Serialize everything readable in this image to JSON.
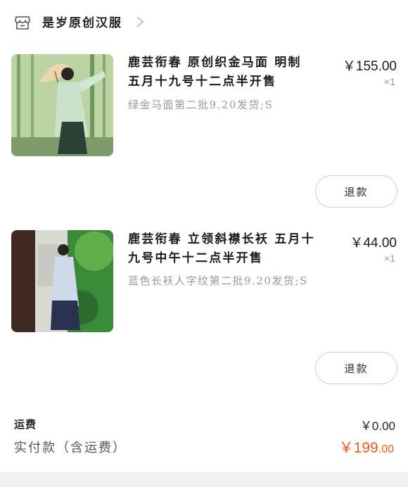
{
  "header": {
    "shop_name": "是岁原创汉服"
  },
  "items": [
    {
      "title_line1": "鹿芸衔春 原创织金马面 明制",
      "title_line2": "五月十九号十二点半开售",
      "sku": "绿金马面第二批9.20发货;S",
      "price": "￥155.00",
      "qty": "×1",
      "refund_label": "退款"
    },
    {
      "title_line1": "鹿芸衔春 立领斜襟长袄 五月十",
      "title_line2": "九号中午十二点半开售",
      "sku": "蓝色长袄人字纹第二批9.20发货;S",
      "price": "￥44.00",
      "qty": "×1",
      "refund_label": "退款"
    }
  ],
  "summary": {
    "shipping_label": "运费",
    "shipping_value": "￥0.00",
    "paid_label": "实付款（含运费）",
    "paid_prefix": "￥199",
    "paid_suffix": ".00",
    "accent_color": "#ef5a1e"
  },
  "icons": {
    "store": "store-icon",
    "chevron": "chevron-right-icon"
  }
}
